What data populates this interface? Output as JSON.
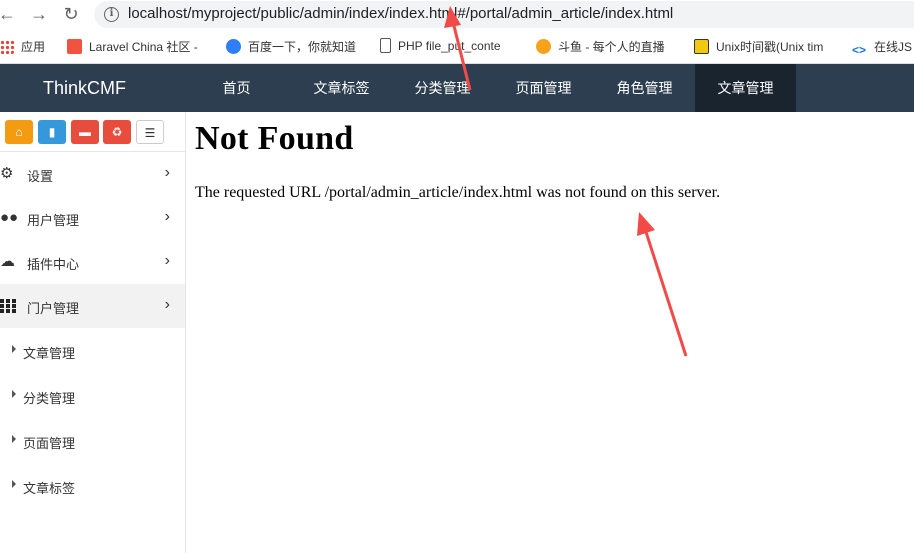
{
  "browser": {
    "url": "localhost/myproject/public/admin/index/index.html#/portal/admin_article/index.html",
    "bookmarks": [
      {
        "label": "应用",
        "icon": "apps-grid-icon"
      },
      {
        "label": "Laravel China 社区 -",
        "icon": "laravel-icon"
      },
      {
        "label": "百度一下，你就知道",
        "icon": "baidu-paw-icon"
      },
      {
        "label": "PHP file_put_conte",
        "icon": "document-icon"
      },
      {
        "label": "斗鱼 - 每个人的直播",
        "icon": "douyu-icon"
      },
      {
        "label": "Unix时间戳(Unix tim",
        "icon": "unix-time-icon"
      },
      {
        "label": "在线JS",
        "icon": "code-brackets-icon"
      }
    ]
  },
  "app": {
    "brand": "ThinkCMF",
    "topnav": [
      "首页",
      "文章标签",
      "分类管理",
      "页面管理",
      "角色管理",
      "文章管理"
    ],
    "topnav_active": "文章管理"
  },
  "sidebar": {
    "shortcuts": [
      {
        "icon": "home-icon",
        "color": "#f39c12"
      },
      {
        "icon": "file-icon",
        "color": "#3498db"
      },
      {
        "icon": "trash-icon",
        "color": "#e74c3c"
      },
      {
        "icon": "recycle-icon",
        "color": "#e74c3c"
      },
      {
        "icon": "list-icon",
        "color": "#ffffff"
      }
    ],
    "menu": [
      {
        "label": "设置",
        "icon": "gears-icon"
      },
      {
        "label": "用户管理",
        "icon": "users-icon"
      },
      {
        "label": "插件中心",
        "icon": "cloud-icon"
      },
      {
        "label": "门户管理",
        "icon": "grid-icon"
      }
    ],
    "submenu": [
      "文章管理",
      "分类管理",
      "页面管理",
      "文章标签"
    ]
  },
  "content": {
    "title": "Not Found",
    "message": "The requested URL /portal/admin_article/index.html was not found on this server."
  },
  "annotations": {
    "arrow_color": "#f24a46"
  }
}
